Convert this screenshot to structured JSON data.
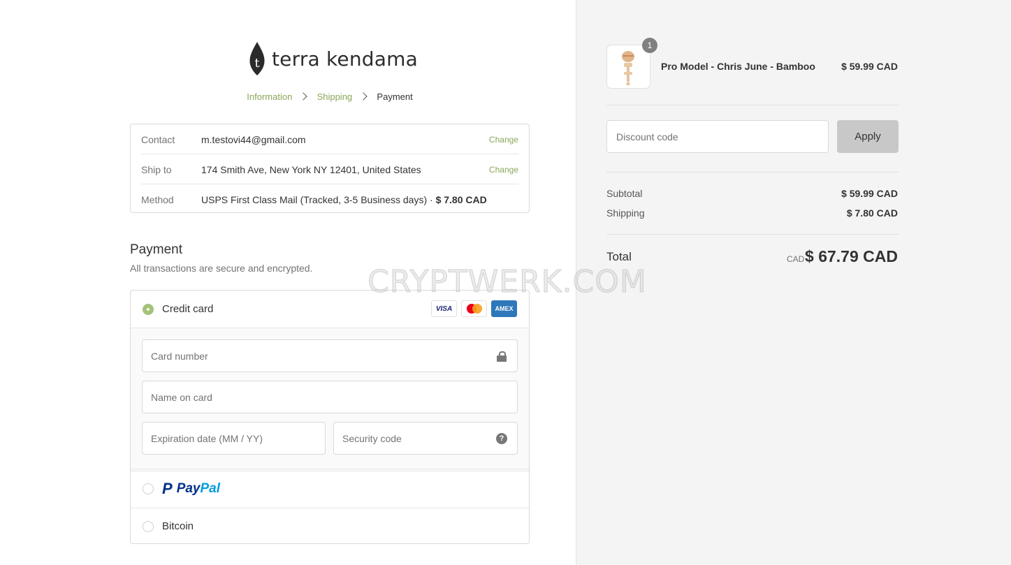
{
  "brand": {
    "name": "terra kendama",
    "accent_color": "#8aa65a"
  },
  "breadcrumb": [
    {
      "label": "Information"
    },
    {
      "label": "Shipping"
    },
    {
      "label": "Payment"
    }
  ],
  "review": {
    "contact_label": "Contact",
    "contact_value": "m.testovi44@gmail.com",
    "ship_label": "Ship to",
    "ship_value": "174 Smith Ave, New York NY 12401, United States",
    "method_label": "Method",
    "method_value": "USPS First Class Mail (Tracked, 3-5 Business days) · ",
    "method_price": "$ 7.80 CAD",
    "change_label": "Change"
  },
  "payment": {
    "title": "Payment",
    "subtitle": "All transactions are secure and encrypted.",
    "credit_card_label": "Credit card",
    "card_brands": {
      "visa": "VISA",
      "amex": "AMEX"
    },
    "card_number_placeholder": "Card number",
    "name_on_card_placeholder": "Name on card",
    "expiration_placeholder": "Expiration date (MM / YY)",
    "security_code_placeholder": "Security code",
    "help_symbol": "?",
    "paypal_label_1": "Pay",
    "paypal_label_2": "Pal",
    "paypal_mark": "P",
    "bitcoin_label": "Bitcoin"
  },
  "order": {
    "item_qty": "1",
    "item_name": "Pro Model - Chris June - Bamboo",
    "item_price": "$ 59.99 CAD",
    "discount_placeholder": "Discount code",
    "apply_label": "Apply",
    "subtotal_label": "Subtotal",
    "subtotal_value": "$ 59.99 CAD",
    "shipping_label": "Shipping",
    "shipping_value": "$ 7.80 CAD",
    "total_label": "Total",
    "total_currency": "CAD",
    "total_value": "$ 67.79 CAD"
  },
  "watermark": "CRYPTWERK.COM"
}
